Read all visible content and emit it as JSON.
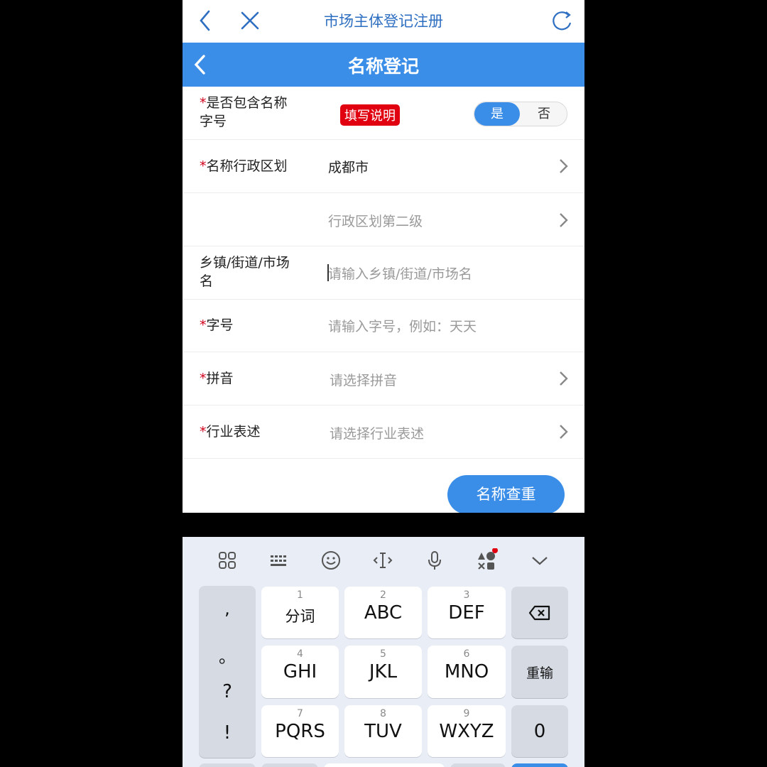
{
  "topbar": {
    "title": "市场主体登记注册"
  },
  "header": {
    "title": "名称登记"
  },
  "rows": {
    "include_name": {
      "req": "*",
      "label_line1": "是否包含名称",
      "label_line2": "字号",
      "badge": "填写说明",
      "yes": "是",
      "no": "否",
      "selected": "是"
    },
    "region": {
      "req": "*",
      "label": "名称行政区划",
      "value": "成都市"
    },
    "region2": {
      "placeholder": "行政区划第二级"
    },
    "town": {
      "label_line1": "乡镇/街道/市场",
      "label_line2": "名",
      "placeholder": "请输入乡镇/街道/市场名"
    },
    "brand": {
      "req": "*",
      "label": "字号",
      "placeholder": "请输入字号，例如：天天"
    },
    "pinyin": {
      "req": "*",
      "label": "拼音",
      "placeholder": "请选择拼音"
    },
    "industry": {
      "req": "*",
      "label": "行业表述",
      "placeholder": "请选择行业表述"
    }
  },
  "check_button": "名称查重",
  "keyboard": {
    "punct": [
      ",",
      "。",
      "?",
      "!"
    ],
    "keys": [
      {
        "num": "1",
        "label": "分词"
      },
      {
        "num": "2",
        "label": "ABC"
      },
      {
        "num": "3",
        "label": "DEF"
      },
      {
        "num": "4",
        "label": "GHI"
      },
      {
        "num": "5",
        "label": "JKL"
      },
      {
        "num": "6",
        "label": "MNO"
      },
      {
        "num": "7",
        "label": "PQRS"
      },
      {
        "num": "8",
        "label": "TUV"
      },
      {
        "num": "9",
        "label": "WXYZ"
      }
    ],
    "reset": "重输",
    "zero": "0",
    "toolbar_icons": [
      "grid-icon",
      "keyboard-icon",
      "emoji-icon",
      "cursor-icon",
      "mic-icon",
      "shapes-icon",
      "collapse-icon"
    ],
    "accent": "#3b8ee8"
  }
}
